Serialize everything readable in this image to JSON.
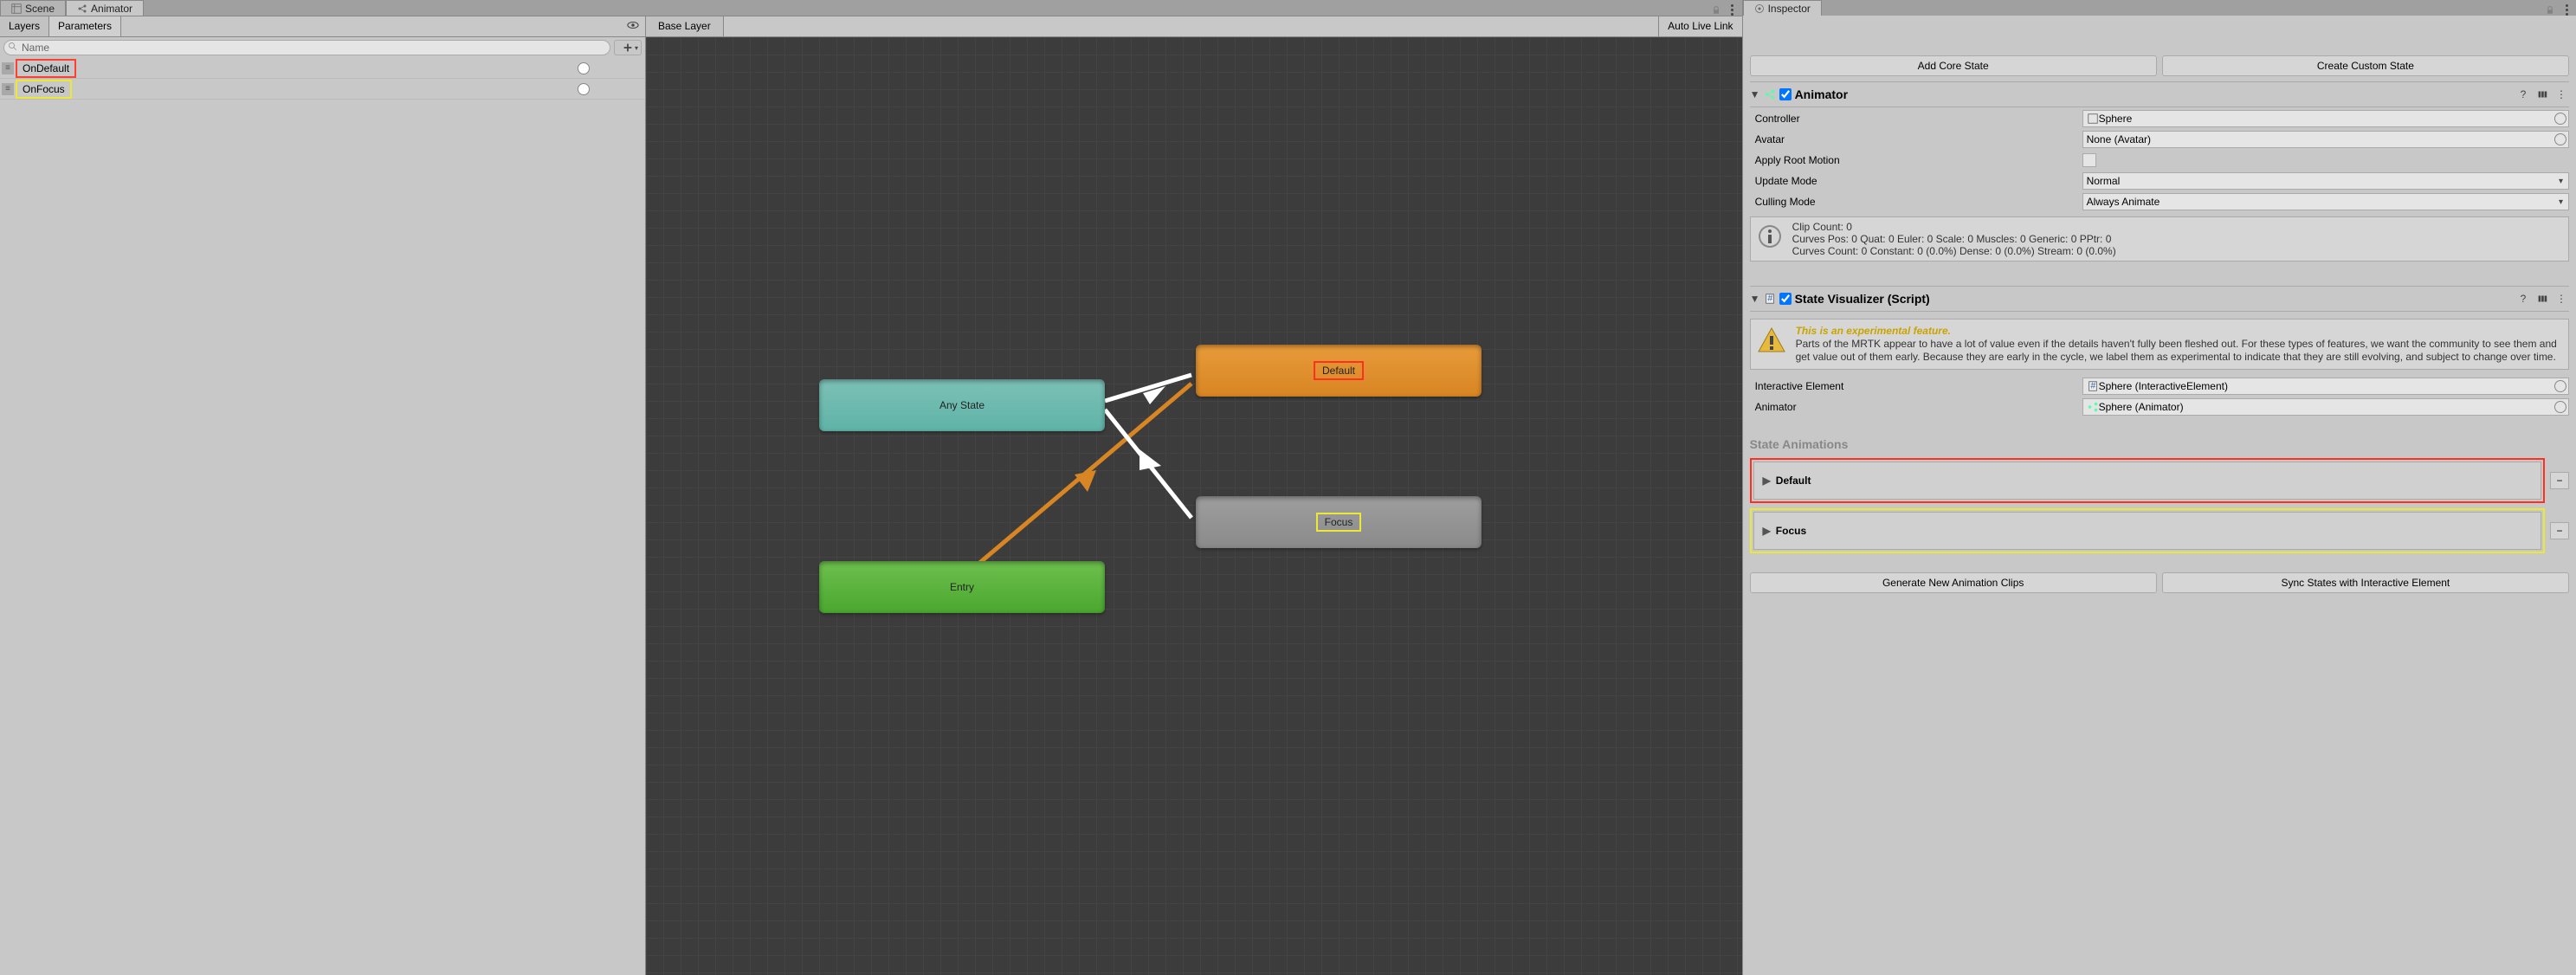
{
  "leftPanel": {
    "tabs": {
      "scene": "Scene",
      "animator": "Animator"
    },
    "subtabs": {
      "layers": "Layers",
      "parameters": "Parameters"
    },
    "search": {
      "placeholder": "Name"
    },
    "params": [
      {
        "name": "OnDefault",
        "highlight": "red"
      },
      {
        "name": "OnFocus",
        "highlight": "yellow"
      }
    ],
    "breadcrumb": "Base Layer",
    "autoLive": "Auto Live Link",
    "nodes": {
      "anyState": "Any State",
      "entry": "Entry",
      "default": "Default",
      "focus": "Focus"
    }
  },
  "inspector": {
    "tab": "Inspector",
    "addCore": "Add Core State",
    "createCustom": "Create Custom State",
    "animator": {
      "title": "Animator",
      "controller": {
        "label": "Controller",
        "value": "Sphere"
      },
      "avatar": {
        "label": "Avatar",
        "value": "None (Avatar)"
      },
      "applyRoot": {
        "label": "Apply Root Motion"
      },
      "updateMode": {
        "label": "Update Mode",
        "value": "Normal"
      },
      "cullingMode": {
        "label": "Culling Mode",
        "value": "Always Animate"
      },
      "clipInfo": {
        "l1": "Clip Count: 0",
        "l2": "Curves Pos: 0 Quat: 0 Euler: 0 Scale: 0 Muscles: 0 Generic: 0 PPtr: 0",
        "l3": "Curves Count: 0 Constant: 0 (0.0%) Dense: 0 (0.0%) Stream: 0 (0.0%)"
      }
    },
    "stateViz": {
      "title": "State Visualizer (Script)",
      "warnTitle": "This is an experimental feature.",
      "warnBody": "Parts of the MRTK appear to have a lot of value even if the details haven't fully been fleshed out. For these types of features, we want the community to see them and get value out of them early. Because they are early in the cycle, we label them as experimental to indicate that they are still evolving, and subject to change over time.",
      "interactiveEl": {
        "label": "Interactive Element",
        "value": "Sphere (InteractiveElement)"
      },
      "animatorRef": {
        "label": "Animator",
        "value": "Sphere (Animator)"
      },
      "sectionTitle": "State Animations",
      "defaultState": "Default",
      "focusState": "Focus",
      "genClips": "Generate New Animation Clips",
      "syncStates": "Sync States with Interactive Element"
    }
  }
}
